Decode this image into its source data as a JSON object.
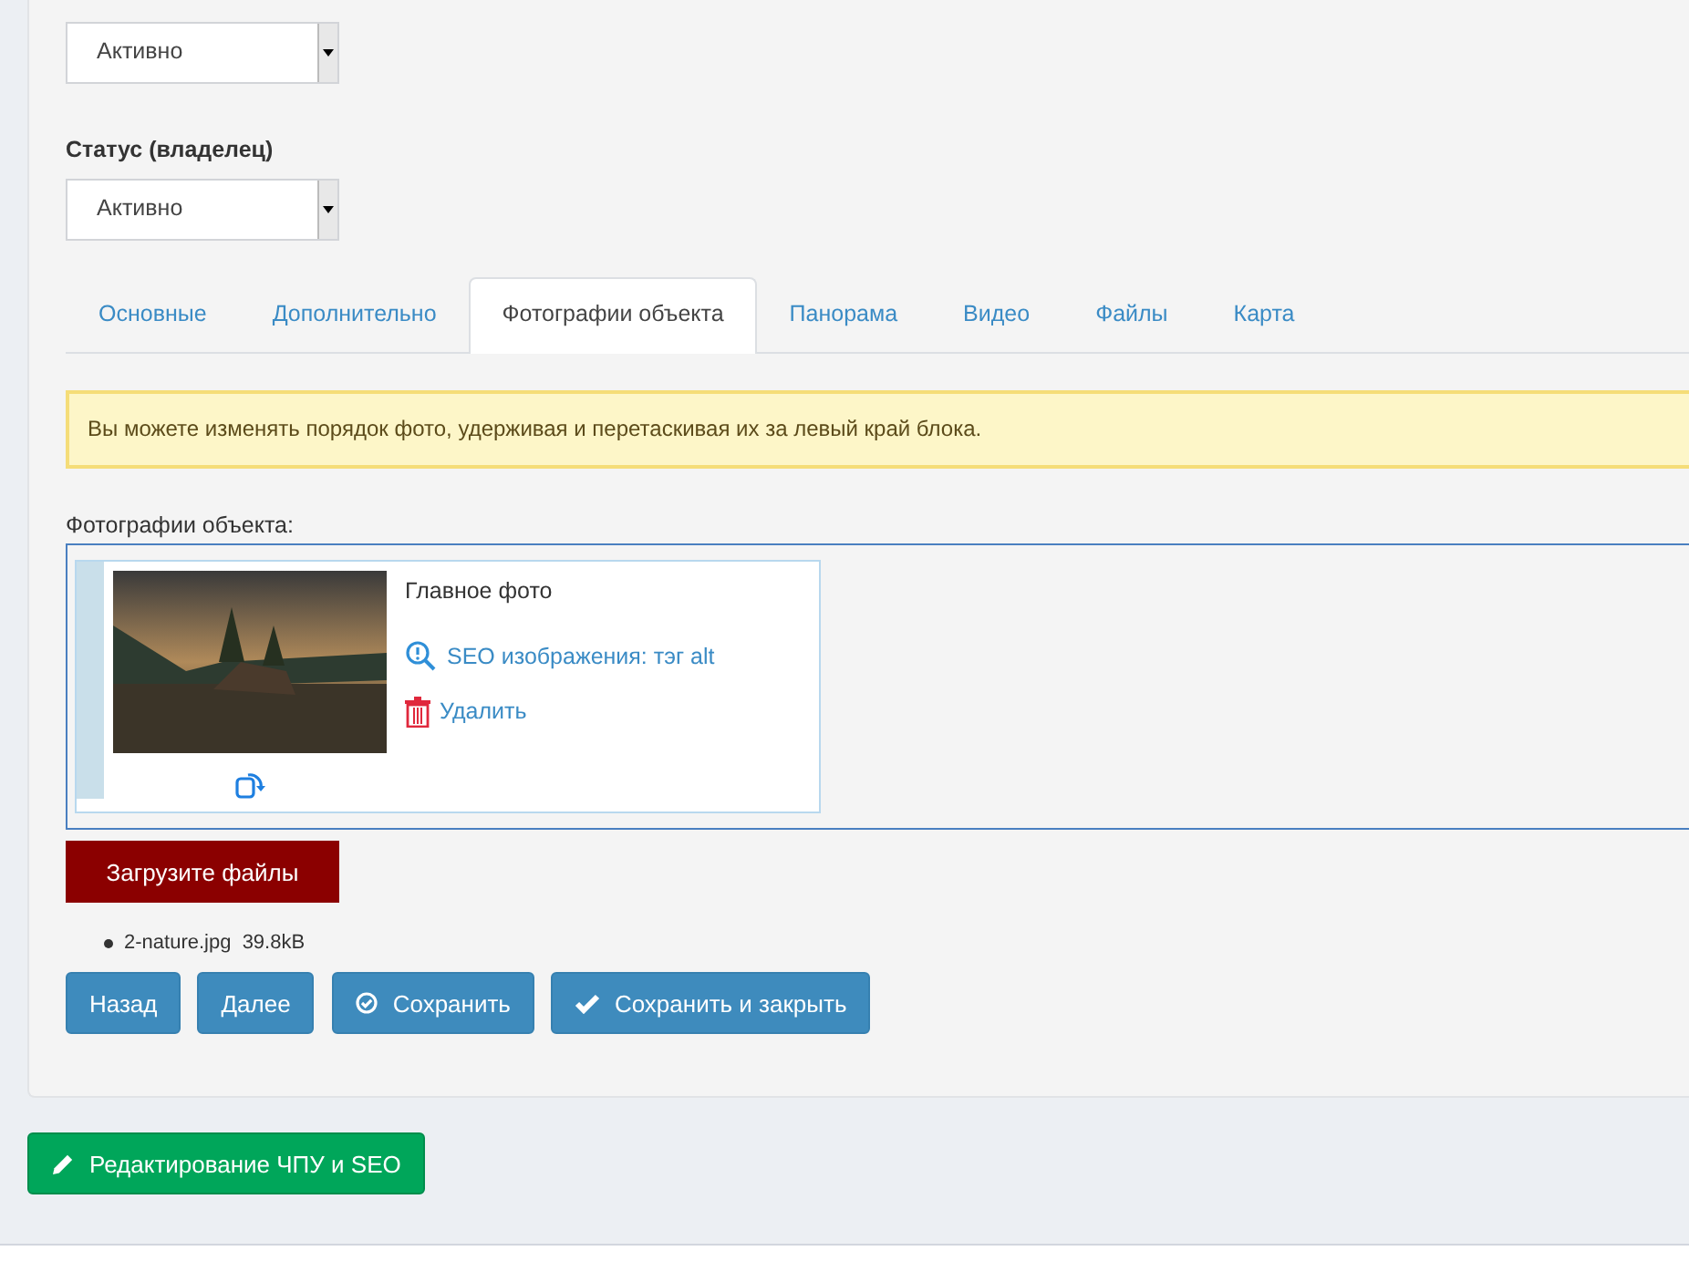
{
  "selects": [
    {
      "value": "Активно"
    },
    {
      "label": "Статус (владелец)",
      "value": "Активно"
    }
  ],
  "tabs": [
    {
      "label": "Основные",
      "selected": false
    },
    {
      "label": "Дополнительно",
      "selected": false
    },
    {
      "label": "Фотографии объекта",
      "selected": true
    },
    {
      "label": "Панорама",
      "selected": false
    },
    {
      "label": "Видео",
      "selected": false
    },
    {
      "label": "Файлы",
      "selected": false
    },
    {
      "label": "Карта",
      "selected": false
    }
  ],
  "alert": "Вы можете изменять порядок фото, удерживая и перетаскивая их за левый край блока.",
  "photos_label": "Фотографии объекта:",
  "photos": [
    {
      "caption": "Главное фото",
      "seo_link": "SEO изображения: тэг alt",
      "delete_link": "Удалить"
    }
  ],
  "upload_button": "Загрузите файлы",
  "files": [
    {
      "name": "2-nature.jpg",
      "size": "39.8kB"
    }
  ],
  "buttons": [
    {
      "label": "Назад",
      "kind": "plain"
    },
    {
      "label": "Далее",
      "kind": "plain"
    },
    {
      "label": "Сохранить",
      "kind": "save"
    },
    {
      "label": "Сохранить и закрыть",
      "kind": "save_close"
    }
  ],
  "seo_button": "Редактирование ЧПУ и SEO"
}
